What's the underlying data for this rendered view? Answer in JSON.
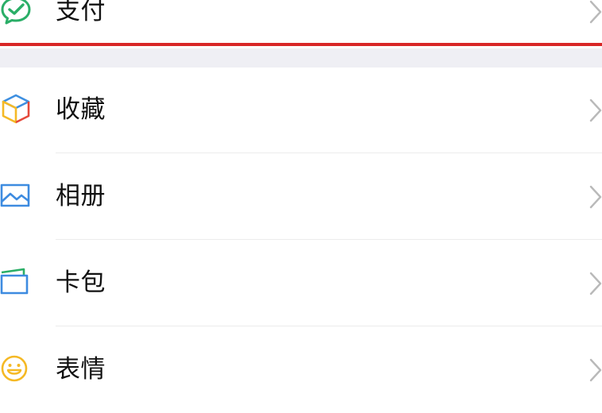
{
  "menu": {
    "items": [
      {
        "id": "pay",
        "label": "支付",
        "icon": "wechat-pay-icon",
        "accent": "#2aae67"
      },
      {
        "id": "favorites",
        "label": "收藏",
        "icon": "favorites-cube-icon",
        "accent": "#3e8fe0"
      },
      {
        "id": "photos",
        "label": "相册",
        "icon": "photo-album-icon",
        "accent": "#3d8be0"
      },
      {
        "id": "cards",
        "label": "卡包",
        "icon": "card-wallet-icon",
        "accent": "#3d8be0"
      },
      {
        "id": "stickers",
        "label": "表情",
        "icon": "sticker-smiley-icon",
        "accent": "#f5b925"
      }
    ],
    "chevron_icon": "chevron-right-icon",
    "highlight_color": "#d82626"
  }
}
